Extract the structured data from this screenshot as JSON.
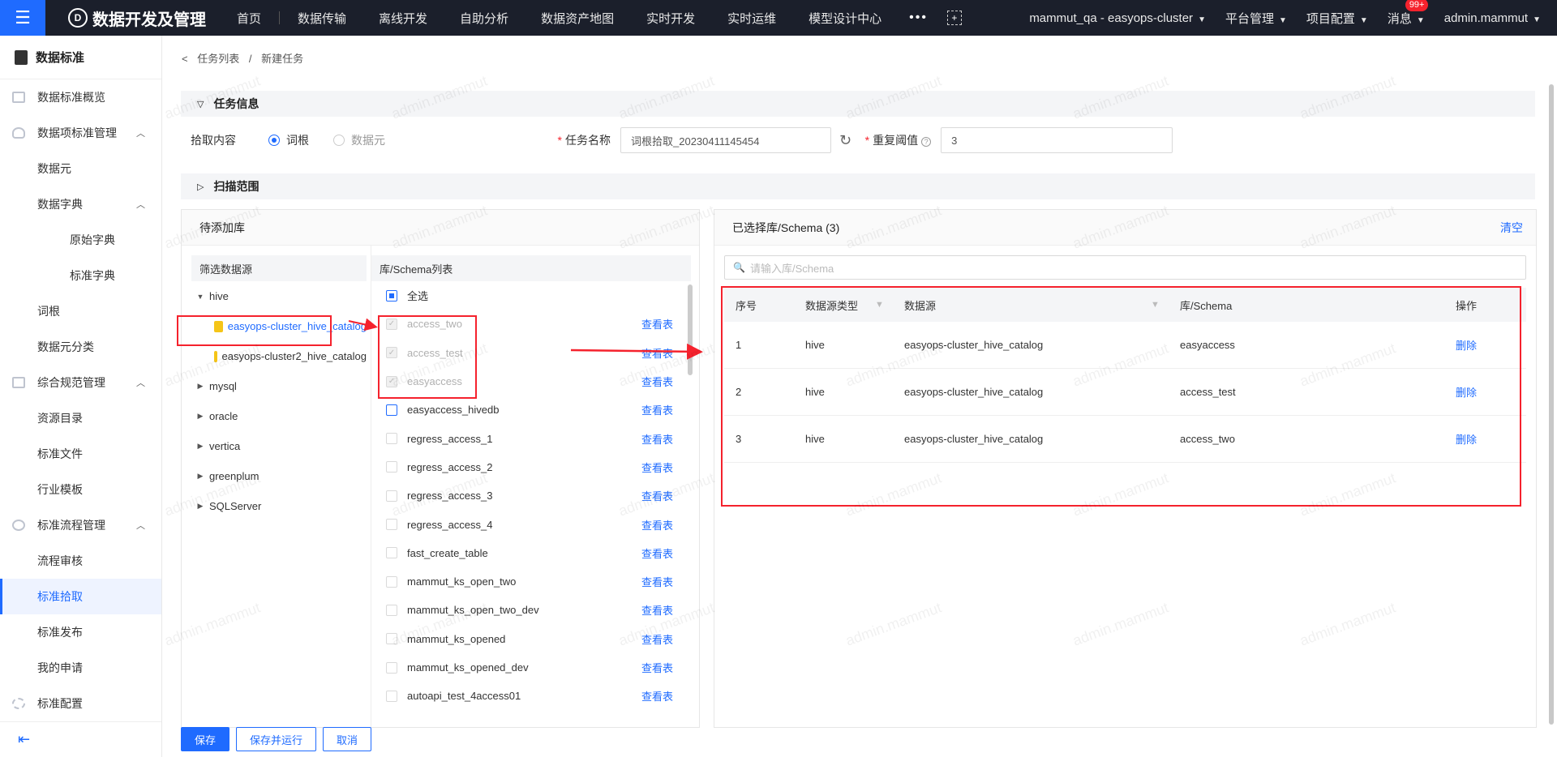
{
  "topbar": {
    "menu_icon": "hamburger-icon",
    "app_title": "数据开发及管理",
    "nav": [
      "首页",
      "数据传输",
      "离线开发",
      "自助分析",
      "数据资产地图",
      "实时开发",
      "实时运维",
      "模型设计中心"
    ],
    "more": "•••",
    "cluster": "mammut_qa - easyops-cluster",
    "platform": "平台管理",
    "project": "项目配置",
    "messages": "消息",
    "badge": "99+",
    "user": "admin.mammut"
  },
  "sidebar": {
    "title": "数据标准",
    "items": [
      {
        "label": "数据标准概览",
        "level": 1
      },
      {
        "label": "数据项标准管理",
        "level": 1,
        "expanded": true
      },
      {
        "label": "数据元",
        "level": 2
      },
      {
        "label": "数据字典",
        "level": 2,
        "expanded": true
      },
      {
        "label": "原始字典",
        "level": 3
      },
      {
        "label": "标准字典",
        "level": 3
      },
      {
        "label": "词根",
        "level": 2
      },
      {
        "label": "数据元分类",
        "level": 2
      },
      {
        "label": "综合规范管理",
        "level": 1,
        "expanded": true
      },
      {
        "label": "资源目录",
        "level": 2
      },
      {
        "label": "标准文件",
        "level": 2
      },
      {
        "label": "行业模板",
        "level": 2
      },
      {
        "label": "标准流程管理",
        "level": 1,
        "expanded": true
      },
      {
        "label": "流程审核",
        "level": 2
      },
      {
        "label": "标准拾取",
        "level": 2,
        "active": true
      },
      {
        "label": "标准发布",
        "level": 2
      },
      {
        "label": "我的申请",
        "level": 2
      },
      {
        "label": "标准配置",
        "level": 1
      }
    ]
  },
  "breadcrumb": {
    "back": "<",
    "parent": "任务列表",
    "sep": "/",
    "current": "新建任务"
  },
  "task_info": {
    "section_title": "任务信息",
    "pick_label": "拾取内容",
    "radio_1": "词根",
    "radio_2": "数据元",
    "name_label": "任务名称",
    "name_value": "词根拾取_20230411145454",
    "threshold_label": "重复阈值",
    "threshold_value": "3"
  },
  "scan": {
    "section_title": "扫描范围",
    "left_title": "待添加库",
    "filter_title": "筛选数据源",
    "tree": [
      {
        "label": "hive",
        "type": "group",
        "expanded": true
      },
      {
        "label": "easyops-cluster_hive_catalog",
        "type": "ds",
        "selected": true
      },
      {
        "label": "easyops-cluster2_hive_catalog",
        "type": "ds"
      },
      {
        "label": "mysql",
        "type": "group"
      },
      {
        "label": "oracle",
        "type": "group"
      },
      {
        "label": "vertica",
        "type": "group"
      },
      {
        "label": "greenplum",
        "type": "group"
      },
      {
        "label": "SQLServer",
        "type": "group"
      }
    ],
    "schema_title": "库/Schema列表",
    "select_all": "全选",
    "view_label": "查看表",
    "schemas": [
      {
        "name": "access_two",
        "checked": true
      },
      {
        "name": "access_test",
        "checked": true
      },
      {
        "name": "easyaccess",
        "checked": true
      },
      {
        "name": "easyaccess_hivedb",
        "checked": false
      },
      {
        "name": "regress_access_1",
        "checked": false
      },
      {
        "name": "regress_access_2",
        "checked": false
      },
      {
        "name": "regress_access_3",
        "checked": false
      },
      {
        "name": "regress_access_4",
        "checked": false
      },
      {
        "name": "fast_create_table",
        "checked": false
      },
      {
        "name": "mammut_ks_open_two",
        "checked": false
      },
      {
        "name": "mammut_ks_open_two_dev",
        "checked": false
      },
      {
        "name": "mammut_ks_opened",
        "checked": false
      },
      {
        "name": "mammut_ks_opened_dev",
        "checked": false
      },
      {
        "name": "autoapi_test_4access01",
        "checked": false
      }
    ],
    "right_title": "已选择库/Schema (3)",
    "clear": "清空",
    "search_placeholder": "请输入库/Schema",
    "table": {
      "headers": [
        "序号",
        "数据源类型",
        "数据源",
        "库/Schema",
        "操作"
      ],
      "rows": [
        [
          "1",
          "hive",
          "easyops-cluster_hive_catalog",
          "easyaccess",
          "删除"
        ],
        [
          "2",
          "hive",
          "easyops-cluster_hive_catalog",
          "access_test",
          "删除"
        ],
        [
          "3",
          "hive",
          "easyops-cluster_hive_catalog",
          "access_two",
          "删除"
        ]
      ]
    }
  },
  "footer": {
    "save": "保存",
    "save_run": "保存并运行",
    "cancel": "取消"
  },
  "watermark": "admin.mammut",
  "colors": {
    "accent": "#1f6bff",
    "topbar": "#1b1f2b",
    "annotation": "#f5222d"
  }
}
